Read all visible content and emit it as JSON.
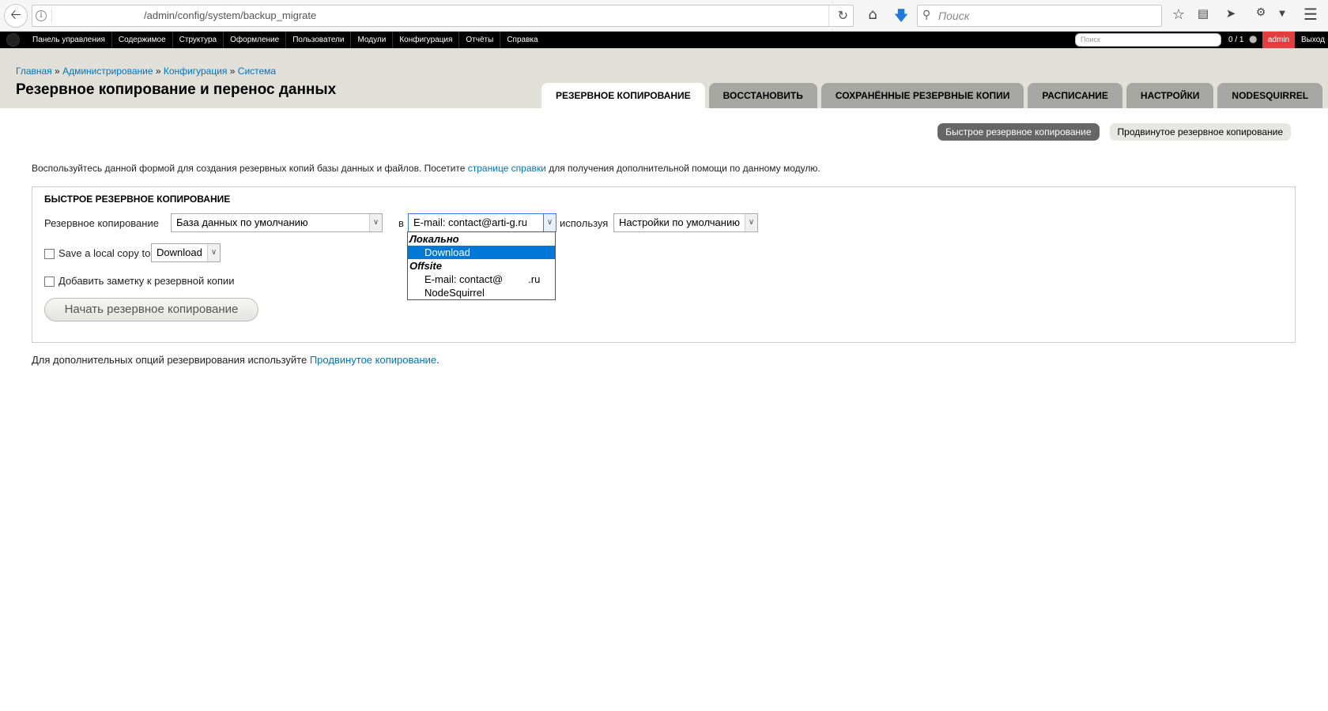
{
  "browser": {
    "url": "/admin/config/system/backup_migrate",
    "search_placeholder": "Поиск"
  },
  "admin_toolbar": {
    "menu": [
      "Панель управления",
      "Содержимое",
      "Структура",
      "Оформление",
      "Пользователи",
      "Модули",
      "Конфигурация",
      "Отчёты",
      "Справка"
    ],
    "search_placeholder": "Поиск",
    "users_online": "0 / 1",
    "user": "admin",
    "logout": "Выход"
  },
  "breadcrumb": {
    "items": [
      "Главная",
      "Администрирование",
      "Конфигурация",
      "Система"
    ],
    "separator": "»"
  },
  "page_title": "Резервное копирование и перенос данных",
  "tabs": [
    {
      "label": "Резервное копирование",
      "active": true
    },
    {
      "label": "Восстановить",
      "active": false
    },
    {
      "label": "Сохранённые резервные копии",
      "active": false
    },
    {
      "label": "Расписание",
      "active": false
    },
    {
      "label": "Настройки",
      "active": false
    },
    {
      "label": "NodeSquirrel",
      "active": false
    }
  ],
  "secondary_tabs": [
    {
      "label": "Быстрое резервное копирование",
      "active": true
    },
    {
      "label": "Продвинутое резервное копирование",
      "active": false
    }
  ],
  "intro": {
    "before": "Воспользуйтесь данной формой для создания резервных копий базы данных и файлов. Посетите ",
    "link": "странице справки",
    "after": " для получения дополнительной помощи по данному модулю."
  },
  "form": {
    "legend": "Быстрое резервное копирование",
    "label_backup": "Резервное копирование",
    "source_value": "База данных по умолчанию",
    "label_to": "в",
    "destination_value": "E-mail: contact@arti-g.ru",
    "label_using": "используя",
    "profile_value": "Настройки по умолчанию",
    "local_copy_label": "Save a local copy to",
    "local_copy_value": "Download",
    "local_copy_checked": false,
    "note_label": "Добавить заметку к резервной копии",
    "note_checked": false,
    "submit": "Начать резервное копирование"
  },
  "destination_dropdown": {
    "groups": [
      {
        "label": "Локально",
        "options": [
          {
            "label": "Download",
            "selected": true
          }
        ]
      },
      {
        "label": "Offsite",
        "options": [
          {
            "prefix": "E-mail: contact@",
            "suffix": ".ru",
            "selected": false
          },
          {
            "label": "NodeSquirrel",
            "selected": false
          }
        ]
      }
    ]
  },
  "footer_note": {
    "before": "Для дополнительных опций резервирования используйте ",
    "link": "Продвинутое копирование",
    "after": "."
  },
  "colors": {
    "link": "#0074bd",
    "admin_badge": "#e43d3d",
    "selected_option": "#0078d7",
    "header_bg": "#e0e0d8"
  }
}
